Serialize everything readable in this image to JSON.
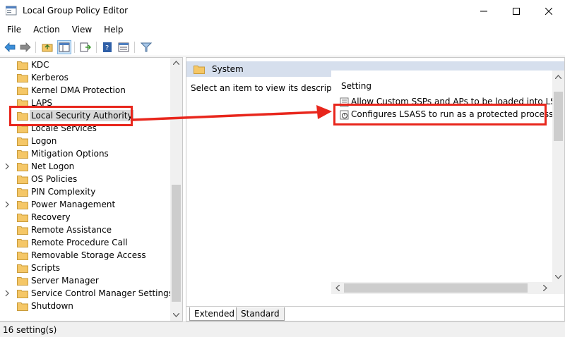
{
  "window": {
    "title": "Local Group Policy Editor"
  },
  "menu": [
    "File",
    "Action",
    "View",
    "Help"
  ],
  "tree": {
    "items": [
      {
        "label": "KDC",
        "expandable": false
      },
      {
        "label": "Kerberos",
        "expandable": false
      },
      {
        "label": "Kernel DMA Protection",
        "expandable": false
      },
      {
        "label": "LAPS",
        "expandable": false
      },
      {
        "label": "Local Security Authority",
        "expandable": false,
        "selected": true
      },
      {
        "label": "Locale Services",
        "expandable": false
      },
      {
        "label": "Logon",
        "expandable": false
      },
      {
        "label": "Mitigation Options",
        "expandable": false
      },
      {
        "label": "Net Logon",
        "expandable": true
      },
      {
        "label": "OS Policies",
        "expandable": false
      },
      {
        "label": "PIN Complexity",
        "expandable": false
      },
      {
        "label": "Power Management",
        "expandable": true
      },
      {
        "label": "Recovery",
        "expandable": false
      },
      {
        "label": "Remote Assistance",
        "expandable": false
      },
      {
        "label": "Remote Procedure Call",
        "expandable": false
      },
      {
        "label": "Removable Storage Access",
        "expandable": false
      },
      {
        "label": "Scripts",
        "expandable": false
      },
      {
        "label": "Server Manager",
        "expandable": false
      },
      {
        "label": "Service Control Manager Settings",
        "expandable": true
      },
      {
        "label": "Shutdown",
        "expandable": false
      }
    ]
  },
  "right": {
    "header": "System",
    "description": "Select an item to view its description.",
    "setting_header": "Setting",
    "settings": [
      {
        "label": "Allow Custom SSPs and APs to be loaded into LSASS"
      },
      {
        "label": "Configures LSASS to run as a protected process"
      }
    ],
    "tabs": [
      "Extended",
      "Standard"
    ]
  },
  "status": {
    "text": "16 setting(s)"
  },
  "colors": {
    "annotation": "#e8261c",
    "header_bg": "#d6dfed",
    "folder": "#f5c767"
  }
}
